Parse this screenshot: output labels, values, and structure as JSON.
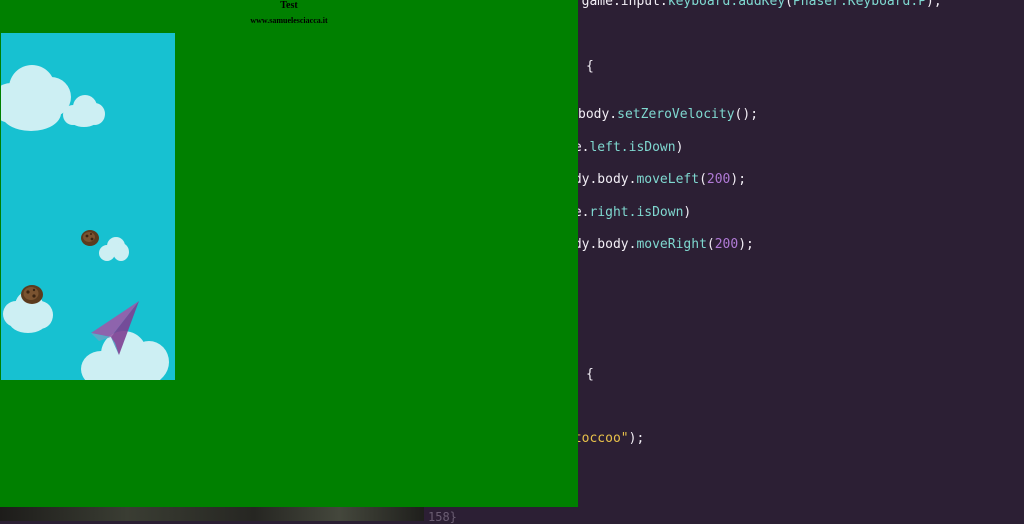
{
  "page": {
    "title": "Test",
    "site": "www.samuelesciacca.it"
  },
  "game": {
    "sprites": [
      "cloud",
      "cloud",
      "cloud",
      "cloud",
      "cloud",
      "rock",
      "rock",
      "paper-plane"
    ]
  },
  "editor": {
    "lines": [
      {
        "prefix": "= game.input.",
        "fn": "keyboard.addKey",
        "mid": "(",
        "fn2": "Phaser.Keyboard.P",
        "suffix": ");"
      },
      {
        "prefix": "{"
      },
      {
        "prefix": "body.",
        "fn": "setZeroVelocity",
        "suffix": "();"
      },
      {
        "prefix": "re.",
        "fn": "left.isDown",
        "suffix": ")"
      },
      {
        "prefix": "ndy.body.",
        "fn": "moveLeft",
        "mid": "(",
        "num": "200",
        "suffix": ");"
      },
      {
        "prefix": "re.",
        "fn": "right.isDown",
        "suffix": ")"
      },
      {
        "prefix": "ndy.body.",
        "fn": "moveRight",
        "mid": "(",
        "num": "200",
        "suffix": ");"
      },
      {
        "prefix": "{"
      },
      {
        "str": "rtoccoo\"",
        "suffix": ");"
      }
    ],
    "gutter_line": "158}"
  }
}
